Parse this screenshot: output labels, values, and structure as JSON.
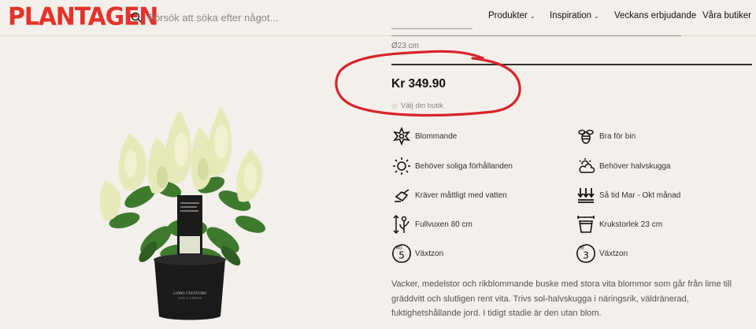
{
  "header": {
    "logo": "PLANTAGEN",
    "search_placeholder": "Försök att söka efter något...",
    "nav": [
      {
        "label": "Produkter",
        "has_dropdown": true
      },
      {
        "label": "Inspiration",
        "has_dropdown": true
      },
      {
        "label": "Veckans erbjudande",
        "has_dropdown": false
      },
      {
        "label": "Våra butiker",
        "has_dropdown": false
      }
    ]
  },
  "product": {
    "size_text": "Ø23 cm",
    "price": "Kr 349.90",
    "store_link": "Välj din butik",
    "pot_label": "LIVING CREATIONS",
    "pot_sublabel": "LOST & CURIOUS",
    "features": [
      {
        "icon": "flower-icon",
        "label": "Blommande"
      },
      {
        "icon": "bee-icon",
        "label": "Bra för bin"
      },
      {
        "icon": "sun-icon",
        "label": "Behöver soliga förhållanden"
      },
      {
        "icon": "sun-cloud-icon",
        "label": "Behöver halvskugga"
      },
      {
        "icon": "watering-can-icon",
        "label": "Kräver måttligt med vatten"
      },
      {
        "icon": "planting-time-icon",
        "label": "Så tid Mar - Okt månad"
      },
      {
        "icon": "height-icon",
        "label": "Fullvuxen 80 cm"
      },
      {
        "icon": "pot-icon",
        "label": "Krukstorlek 23 cm"
      },
      {
        "icon": "zone-no-icon",
        "label": "Växtzon",
        "zone": "5",
        "country": "NO"
      },
      {
        "icon": "zone-se-icon",
        "label": "Växtzon",
        "zone": "3",
        "country": "SE"
      }
    ],
    "description": "Vacker, medelstor och rikblommande buske med stora vita blommor som går från lime till gräddvitt och slutligen rent vita. Trivs sol-halvskugga i näringsrik, väldränerad, fuktighetshållande jord. I tidigt stadie är den utan blom."
  },
  "colors": {
    "brand": "#e4322b",
    "annotation": "#d8232a",
    "background": "#f3efea"
  }
}
